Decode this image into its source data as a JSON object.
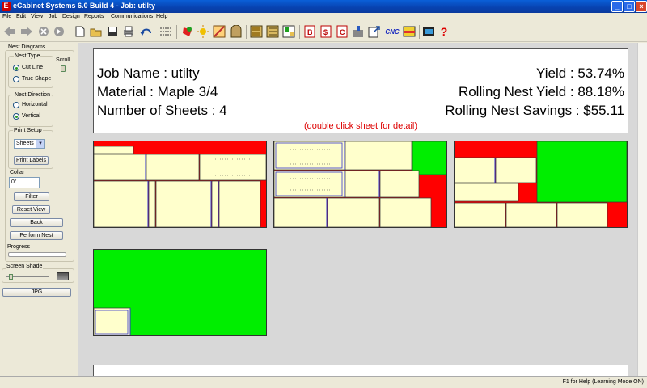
{
  "window": {
    "title": "eCabinet Systems 6.0 Build 4 - Job: utilty",
    "app_icon": "E"
  },
  "menu": [
    "File",
    "Edit",
    "View",
    "Job",
    "Design",
    "Reports",
    "Communications",
    "Help"
  ],
  "toolbar": {
    "cnc_label": "CNC",
    "help_label": "?"
  },
  "left_panel": {
    "nest_diagrams": "Nest Diagrams",
    "nest_type": "Nest Type",
    "scroll": "Scroll",
    "cut_line": "Cut Line",
    "true_shape": "True Shape",
    "nest_direction": "Nest Direction",
    "horizontal": "Horizontal",
    "vertical": "Vertical",
    "print_setup": "Print Setup",
    "sheets_value": "Sheets",
    "print_labels": "Print Labels",
    "collar": "Collar",
    "collar_value": "0\"",
    "filter": "Filter",
    "reset_view": "Reset View",
    "back": "Back",
    "perform_nest": "Perform Nest",
    "progress": "Progress",
    "progress_fraction": 0,
    "screen_shade": "Screen Shade",
    "jpg": "JPG"
  },
  "summary": {
    "job_name": "Job Name :  utilty",
    "material": "Material :  Maple 3/4",
    "sheets": "Number of Sheets :  4",
    "yield": "Yield :  53.74%",
    "rolling_yield": "Rolling Nest Yield :  88.18%",
    "rolling_savings": "Rolling Nest Savings :  $55.11",
    "hint": "(double click sheet for detail)"
  },
  "colors": {
    "part": "#ffffcc",
    "waste": "#ff0000",
    "remnant": "#00ee00",
    "cut_line": "#3333cc"
  },
  "status": {
    "help": "F1 for Help (Learning Mode ON)"
  }
}
